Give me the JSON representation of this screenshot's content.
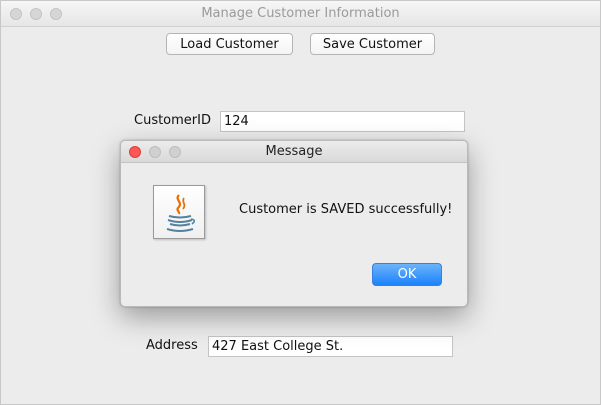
{
  "window": {
    "title": "Manage Customer Information"
  },
  "toolbar": {
    "load_label": "Load Customer",
    "save_label": "Save Customer"
  },
  "form": {
    "customer_id_label": "CustomerID",
    "customer_id_value": "124",
    "address_label": "Address",
    "address_value": "427 East College St."
  },
  "dialog": {
    "title": "Message",
    "message": "Customer is SAVED successfully!",
    "ok_label": "OK",
    "icon": "java-icon"
  },
  "colors": {
    "close_red": "#fc5753",
    "ok_blue": "#1a82fb"
  }
}
